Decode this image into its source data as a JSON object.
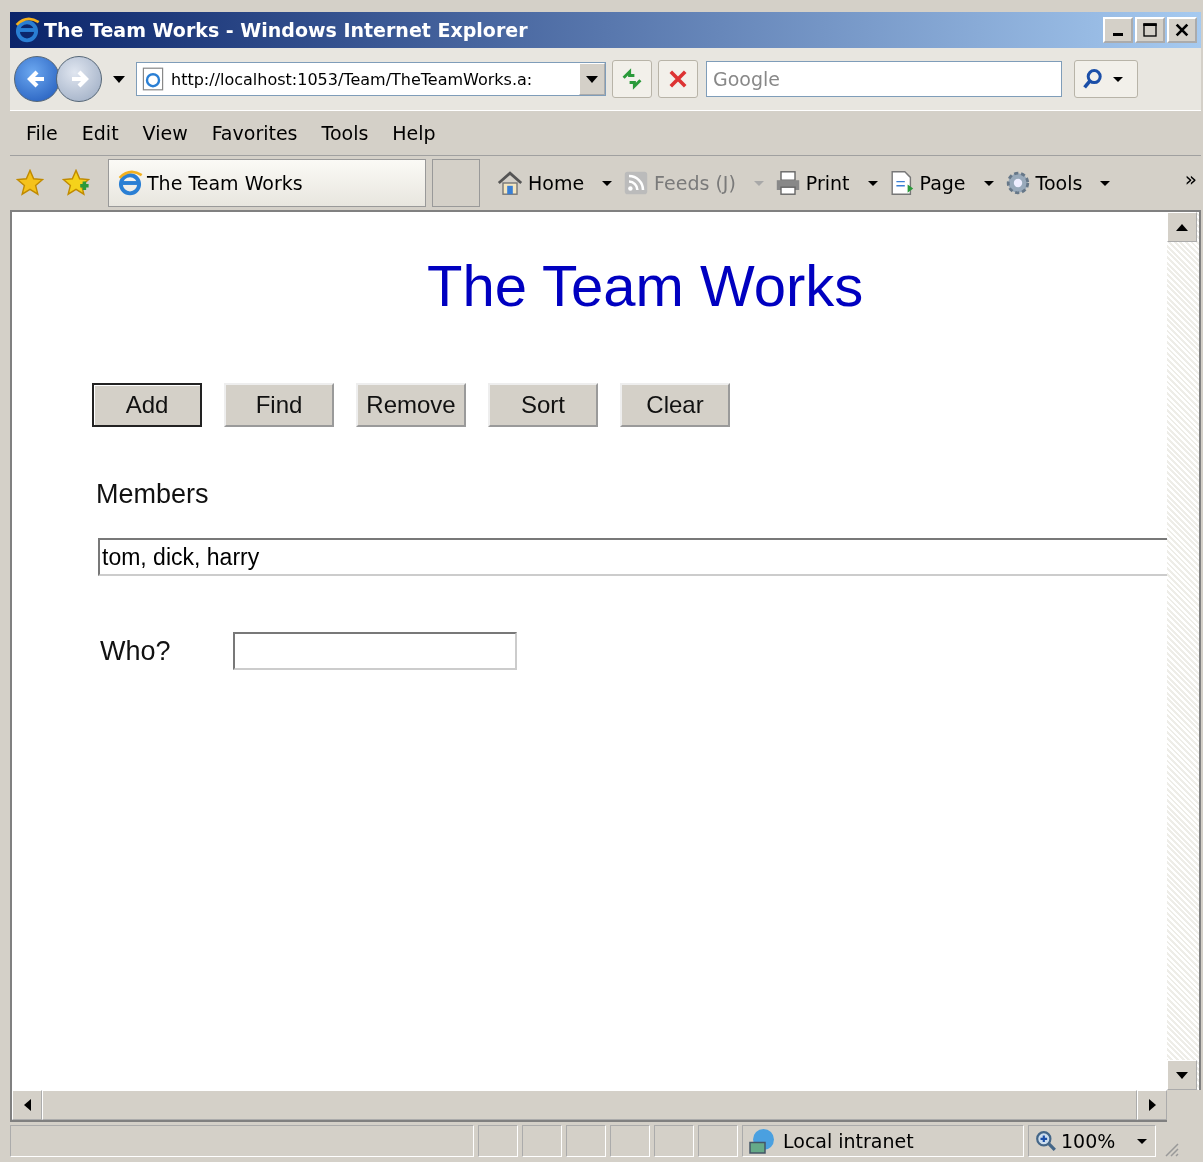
{
  "window": {
    "title": "The Team Works - Windows Internet Explorer"
  },
  "address_bar": {
    "url": "http://localhost:1053/Team/TheTeamWorks.a:"
  },
  "search": {
    "placeholder": "Google"
  },
  "menu": [
    "File",
    "Edit",
    "View",
    "Favorites",
    "Tools",
    "Help"
  ],
  "tab": {
    "title": "The Team Works"
  },
  "command_bar": [
    {
      "label": "Home",
      "kind": "home",
      "disabled": false
    },
    {
      "label": "Feeds (J)",
      "kind": "feeds",
      "disabled": true
    },
    {
      "label": "Print",
      "kind": "print",
      "disabled": false
    },
    {
      "label": "Page",
      "kind": "page",
      "disabled": false
    },
    {
      "label": "Tools",
      "kind": "tools",
      "disabled": false
    }
  ],
  "overflow": "»",
  "page": {
    "heading": "The Team Works",
    "buttons": [
      {
        "label": "Add",
        "focused": true
      },
      {
        "label": "Find",
        "focused": false
      },
      {
        "label": "Remove",
        "focused": false
      },
      {
        "label": "Sort",
        "focused": false
      },
      {
        "label": "Clear",
        "focused": false
      }
    ],
    "members_label": "Members",
    "members_value": "tom, dick, harry",
    "who_label": "Who?"
  },
  "status_bar": {
    "zone": "Local intranet",
    "zoom": "100%"
  }
}
